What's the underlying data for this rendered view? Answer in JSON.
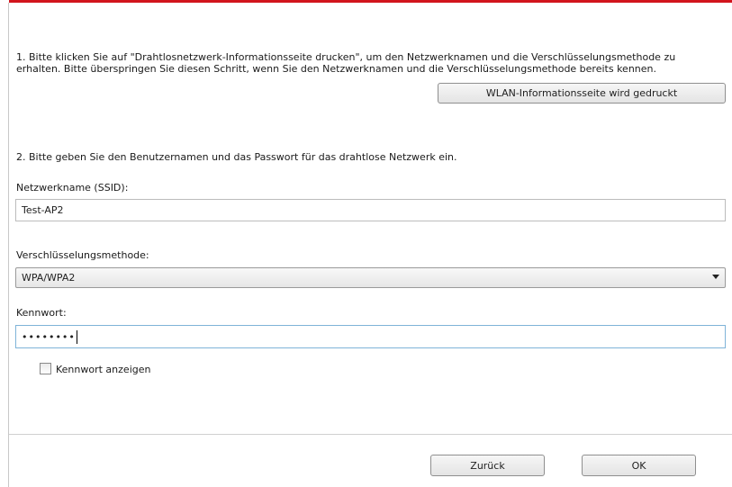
{
  "step1": {
    "line1": "1. Bitte klicken Sie auf \"Drahtlosnetzwerk-Informationsseite drucken\", um den Netzwerknamen und die Verschlüsselungsmethode zu",
    "line2": "erhalten. Bitte überspringen Sie diesen Schritt, wenn Sie den Netzwerknamen und die Verschlüsselungsmethode bereits kennen.",
    "print_button_label": "WLAN-Informationsseite wird gedruckt"
  },
  "step2": {
    "instruction": "2. Bitte geben Sie den Benutzernamen und das Passwort für das drahtlose Netzwerk ein."
  },
  "ssid": {
    "label": "Netzwerkname (SSID):",
    "value": "Test-AP2"
  },
  "encryption": {
    "label": "Verschlüsselungsmethode:",
    "selected": "WPA/WPA2",
    "arrow_icon": "chevron-down-icon"
  },
  "password": {
    "label": "Kennwort:",
    "masked_value": "••••••••"
  },
  "show_password": {
    "label": "Kennwort anzeigen",
    "checked": false
  },
  "footer": {
    "back_label": "Zurück",
    "ok_label": "OK"
  },
  "colors": {
    "accent_bar": "#d2141c",
    "focus_border": "#7fb4d8"
  }
}
